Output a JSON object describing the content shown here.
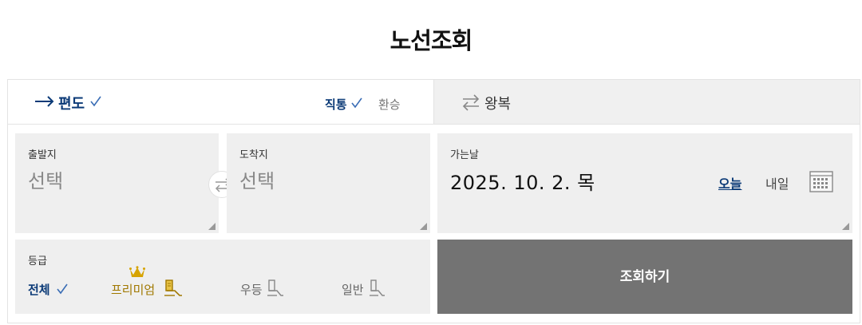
{
  "page": {
    "title": "노선조회"
  },
  "trip_tabs": {
    "oneway": {
      "label": "편도",
      "selected": true
    },
    "roundtrip": {
      "label": "왕복",
      "selected": false
    }
  },
  "route_type": {
    "direct": {
      "label": "직통",
      "selected": true
    },
    "transfer": {
      "label": "환승",
      "selected": false
    }
  },
  "departure": {
    "label": "출발지",
    "value": "선택"
  },
  "arrival": {
    "label": "도착지",
    "value": "선택"
  },
  "date": {
    "label": "가는날",
    "value": "2025. 10. 2. 목",
    "today_label": "오늘",
    "tomorrow_label": "내일"
  },
  "seat_class": {
    "label": "등급",
    "options": [
      {
        "label": "전체",
        "selected": true
      },
      {
        "label": "프리미엄",
        "selected": false
      },
      {
        "label": "우등",
        "selected": false
      },
      {
        "label": "일반",
        "selected": false
      }
    ]
  },
  "search_button": {
    "label": "조회하기"
  },
  "colors": {
    "accent": "#0b3a77",
    "premium": "#a07800",
    "field_bg": "#efefef",
    "button_bg": "#737373"
  },
  "icons": [
    "arrow-right-icon",
    "check-icon",
    "swap-arrows-icon",
    "calendar-icon",
    "crown-icon",
    "seat-icon"
  ]
}
